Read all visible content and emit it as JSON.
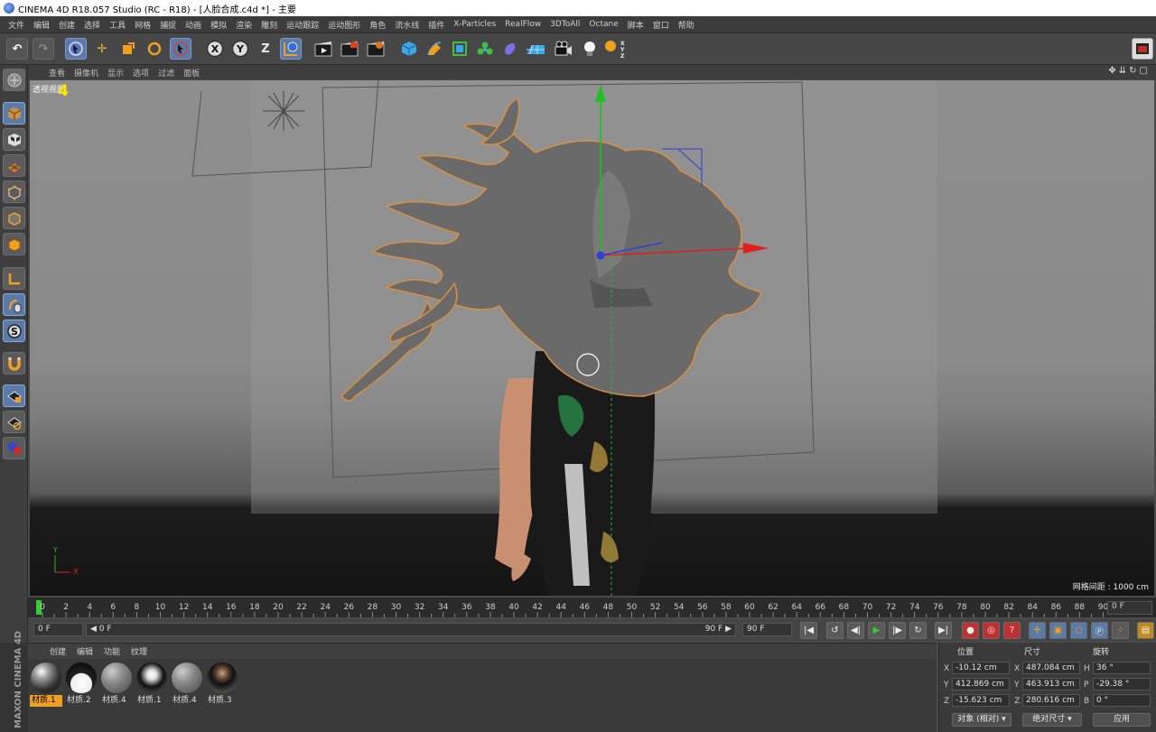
{
  "window": {
    "title": "CINEMA 4D R18.057 Studio (RC - R18) - [人脸合成.c4d *] - 主要"
  },
  "menu": [
    "文件",
    "编辑",
    "创建",
    "选择",
    "工具",
    "网格",
    "捕捉",
    "动画",
    "模拟",
    "渲染",
    "雕刻",
    "运动跟踪",
    "运动图形",
    "角色",
    "流水线",
    "插件",
    "X-Particles",
    "RealFlow",
    "3DToAll",
    "Octane",
    "脚本",
    "窗口",
    "帮助"
  ],
  "toolbar": {
    "axis_x": "X",
    "axis_y": "Y",
    "axis_z": "Z",
    "icons": [
      "undo-icon",
      "redo-icon",
      "live-selection-icon",
      "move-icon",
      "scale-icon",
      "rotate-icon",
      "recent-tool-icon",
      "x-axis-lock-icon",
      "y-axis-lock-icon",
      "z-axis-lock-icon",
      "world-coordinates-icon",
      "render-view-icon",
      "render-picture-viewer-icon",
      "edit-render-settings-icon",
      "cube-icon",
      "pen-spline-icon",
      "subdivision-icon",
      "cloner-icon",
      "deformer-icon",
      "floor-icon",
      "camera-icon",
      "light-icon",
      "coordinate-xyz-icon",
      "layout-switch-icon"
    ]
  },
  "viewport": {
    "menu": [
      "查看",
      "摄像机",
      "显示",
      "选项",
      "过滤",
      "面板"
    ],
    "view_label": "透视视图",
    "view_number": "4",
    "grid_readout": "网格间距 : 1000 cm",
    "axis_y": "Y",
    "axis_x": "X"
  },
  "timeline": {
    "ticks": [
      "0",
      "2",
      "4",
      "6",
      "8",
      "10",
      "12",
      "14",
      "16",
      "18",
      "20",
      "22",
      "24",
      "26",
      "28",
      "30",
      "32",
      "34",
      "36",
      "38",
      "40",
      "42",
      "44",
      "46",
      "48",
      "50",
      "52",
      "54",
      "56",
      "58",
      "60",
      "62",
      "64",
      "66",
      "68",
      "70",
      "72",
      "74",
      "76",
      "78",
      "80",
      "82",
      "84",
      "86",
      "88",
      "90"
    ],
    "current_frame_field": "0 F"
  },
  "transport": {
    "start_field": "0 F",
    "slider_left": "◀ 0 F",
    "slider_right": "90 F ▶",
    "end_field": "90 F"
  },
  "material_manager": {
    "menu": [
      "创建",
      "编辑",
      "功能",
      "纹理"
    ],
    "materials": [
      {
        "name": "材质.1",
        "selected": true,
        "style": "chrome"
      },
      {
        "name": "材质.2",
        "selected": false,
        "style": "white"
      },
      {
        "name": "材质.4",
        "selected": false,
        "style": "grey"
      },
      {
        "name": "材质.1",
        "selected": false,
        "style": "mirror"
      },
      {
        "name": "材质.4",
        "selected": false,
        "style": "grey"
      },
      {
        "name": "材质.3",
        "selected": false,
        "style": "texture"
      }
    ]
  },
  "brand": "MAXON CINEMA 4D",
  "coordinates": {
    "headers": {
      "position": "位置",
      "size": "尺寸",
      "rotation": "旋转"
    },
    "rows": [
      {
        "axis": "X",
        "pos": "-10.12 cm",
        "size_axis": "X",
        "size": "487.084 cm",
        "rot_axis": "H",
        "rot": "36 °"
      },
      {
        "axis": "Y",
        "pos": "412.869 cm",
        "size_axis": "Y",
        "size": "463.913 cm",
        "rot_axis": "P",
        "rot": "-29.38 °"
      },
      {
        "axis": "Z",
        "pos": "-15.623 cm",
        "size_axis": "Z",
        "size": "280.616 cm",
        "rot_axis": "B",
        "rot": "0 °"
      }
    ],
    "mode_dropdown": "对象 (相对)",
    "size_dropdown": "绝对尺寸",
    "apply_button": "应用"
  },
  "colors": {
    "selection_blue": "#5a7aa8",
    "axis_red": "#e02020",
    "axis_green": "#20c020",
    "axis_blue": "#3040d0",
    "highlight_orange": "#f0a020",
    "viewport_number": "#ffe600"
  }
}
